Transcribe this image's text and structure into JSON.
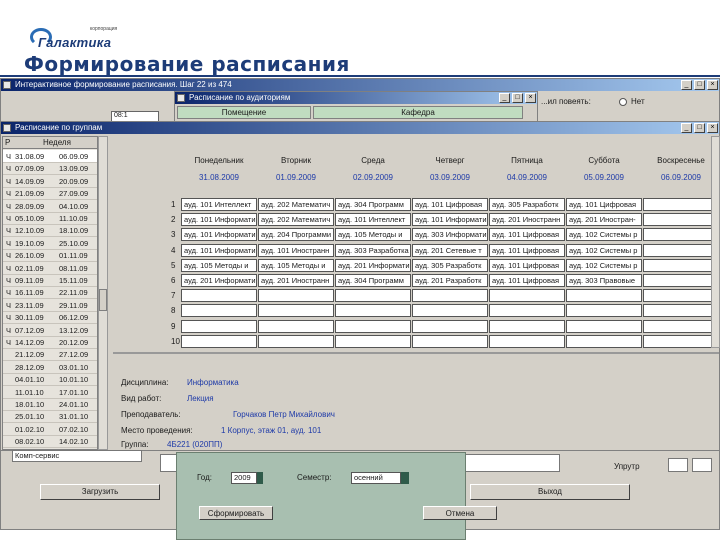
{
  "logo": {
    "sub": "корпорация",
    "main": "Галактика"
  },
  "slide_title": "Формирование расписания",
  "bg_window": {
    "title": "Интерактивное формирование расписания. Шаг 22 из 474",
    "right_label": "...ил повеять:",
    "radio_label": "Нет",
    "field_left": "08:1"
  },
  "room_window": {
    "title": "Расписание по аудиториям",
    "tabs": [
      "Помещение",
      "Кафедра"
    ]
  },
  "group_window": {
    "title": "Расписание по группам",
    "list_headers": [
      "Р",
      "Неделя"
    ],
    "weeks": [
      [
        "Ч",
        "31.08.09",
        "06.09.09"
      ],
      [
        "Ч",
        "07.09.09",
        "13.09.09"
      ],
      [
        "Ч",
        "14.09.09",
        "20.09.09"
      ],
      [
        "Ч",
        "21.09.09",
        "27.09.09"
      ],
      [
        "Ч",
        "28.09.09",
        "04.10.09"
      ],
      [
        "Ч",
        "05.10.09",
        "11.10.09"
      ],
      [
        "Ч",
        "12.10.09",
        "18.10.09"
      ],
      [
        "Ч",
        "19.10.09",
        "25.10.09"
      ],
      [
        "Ч",
        "26.10.09",
        "01.11.09"
      ],
      [
        "Ч",
        "02.11.09",
        "08.11.09"
      ],
      [
        "Ч",
        "09.11.09",
        "15.11.09"
      ],
      [
        "Ч",
        "16.11.09",
        "22.11.09"
      ],
      [
        "Ч",
        "23.11.09",
        "29.11.09"
      ],
      [
        "Ч",
        "30.11.09",
        "06.12.09"
      ],
      [
        "Ч",
        "07.12.09",
        "13.12.09"
      ],
      [
        "Ч",
        "14.12.09",
        "20.12.09"
      ],
      [
        "",
        "21.12.09",
        "27.12.09"
      ],
      [
        "",
        "28.12.09",
        "03.01.10"
      ],
      [
        "",
        "04.01.10",
        "10.01.10"
      ],
      [
        "",
        "11.01.10",
        "17.01.10"
      ],
      [
        "",
        "18.01.10",
        "24.01.10"
      ],
      [
        "",
        "25.01.10",
        "31.01.10"
      ],
      [
        "",
        "01.02.10",
        "07.02.10"
      ],
      [
        "",
        "08.02.10",
        "14.02.10"
      ]
    ],
    "days": [
      "Понедельник",
      "Вторник",
      "Среда",
      "Четверг",
      "Пятница",
      "Суббота",
      "Воскресенье"
    ],
    "dates": [
      "31.08.2009",
      "01.09.2009",
      "02.09.2009",
      "03.09.2009",
      "04.09.2009",
      "05.09.2009",
      "06.09.2009"
    ],
    "row_numbers": [
      "1",
      "2",
      "3",
      "4",
      "5",
      "6",
      "7",
      "8",
      "9",
      "10"
    ],
    "rows": [
      [
        "ауд. 101 Интеллект",
        "ауд. 202 Математич",
        "ауд. 304 Программ",
        "ауд. 101 Цифровая",
        "ауд. 305 Разработк",
        "ауд. 101 Цифровая",
        ""
      ],
      [
        "ауд. 101 Информати",
        "ауд. 202 Математич",
        "ауд. 101 Интеллект",
        "ауд. 101 Информати",
        "ауд. 201 Иностранн",
        "ауд. 201 Иностран-",
        ""
      ],
      [
        "ауд. 101 Информати",
        "ауд. 204 Программи",
        "ауд. 105 Методы и",
        "ауд. 303 Информати",
        "ауд. 101 Цифровая",
        "ауд. 102 Системы р",
        ""
      ],
      [
        "ауд. 101 Информати",
        "ауд. 101 Иностранн",
        "ауд. 303 Разработка",
        "ауд. 201 Сетевые т",
        "ауд. 101 Цифровая",
        "ауд. 102 Системы р",
        ""
      ],
      [
        "ауд. 105 Методы и",
        "ауд. 105 Методы и",
        "ауд. 201 Информати",
        "ауд. 305 Разработк",
        "ауд. 101 Цифровая",
        "ауд. 102 Системы р",
        ""
      ],
      [
        "ауд. 201 Информати",
        "ауд. 201 Иностранн",
        "ауд. 304 Программ",
        "ауд. 201 Разработк",
        "ауд. 101 Цифровая",
        "ауд. 303 Правовые",
        ""
      ],
      [
        "",
        "",
        "",
        "",
        "",
        "",
        ""
      ],
      [
        "",
        "",
        "",
        "",
        "",
        "",
        ""
      ],
      [
        "",
        "",
        "",
        "",
        "",
        "",
        ""
      ],
      [
        "",
        "",
        "",
        "",
        "",
        "",
        ""
      ]
    ],
    "details": {
      "discipline_label": "Дисциплина:",
      "discipline": "Информатика",
      "type_label": "Вид работ:",
      "type": "Лекция",
      "teacher_label": "Преподаватель:",
      "teacher": "Горчаков Петр Михайлович",
      "place_label": "Место проведения:",
      "place": "1 Корпус, этаж 01, ауд. 101",
      "group_label": "Группа:",
      "group": "4Б221 (020ПП)"
    }
  },
  "bottom": {
    "field": "Комп-сервис",
    "unpack": "Упрутр",
    "load_btn": "Загрузить",
    "exit_btn": "Выход"
  },
  "dialog": {
    "year_label": "Год:",
    "year": "2009",
    "semester_label": "Семестр:",
    "semester": "осенний",
    "form_btn": "Сформировать",
    "cancel_btn": "Отмена"
  }
}
